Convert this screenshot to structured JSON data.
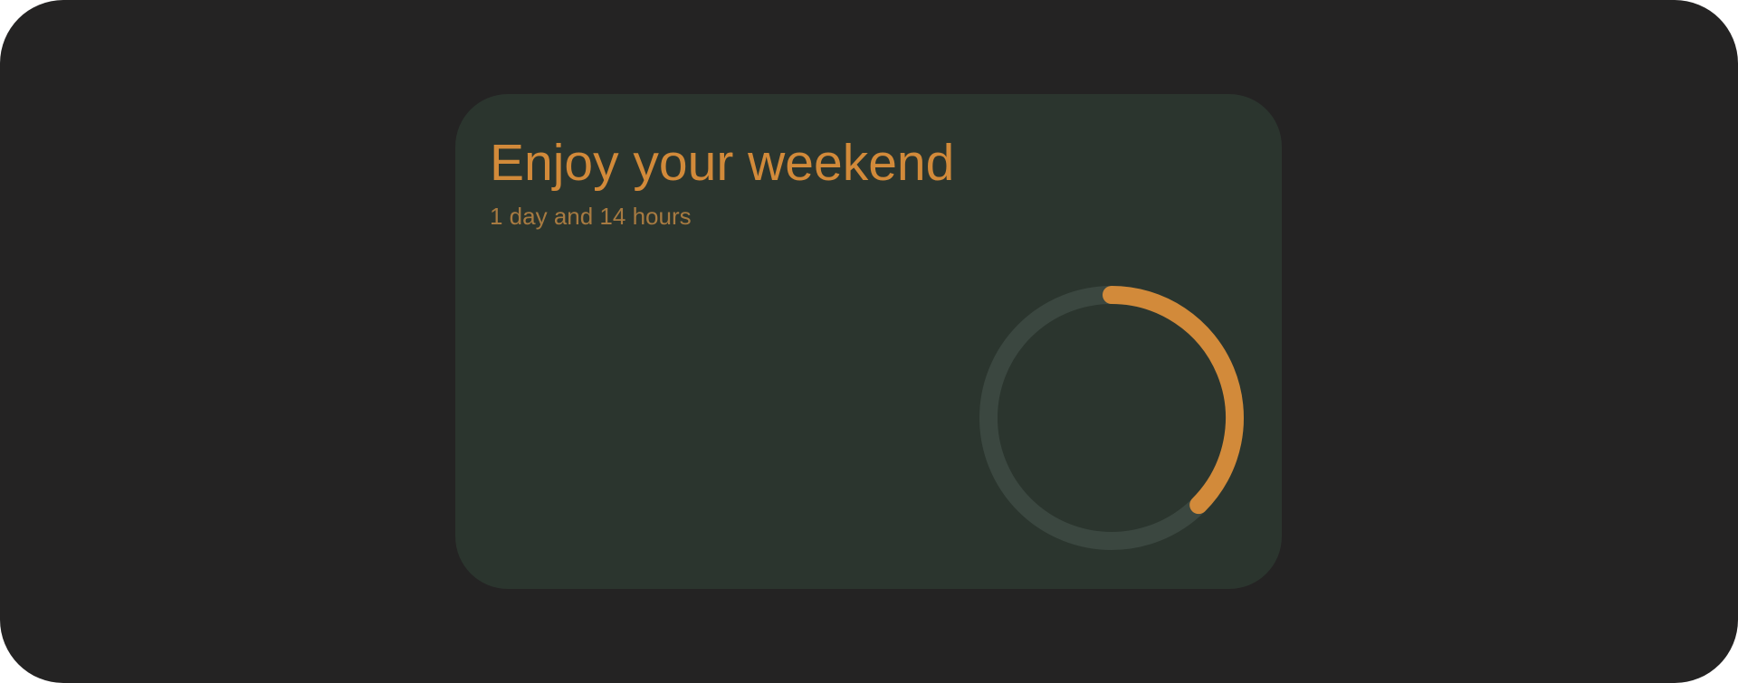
{
  "widget": {
    "title": "Enjoy your weekend",
    "subtitle": "1 day and 14 hours",
    "progress_fraction": 0.375,
    "colors": {
      "background": "#242323",
      "card": "#2b352e",
      "accent": "#d28a3a",
      "subtitle": "#a77a41",
      "track": "#3b4740"
    }
  }
}
